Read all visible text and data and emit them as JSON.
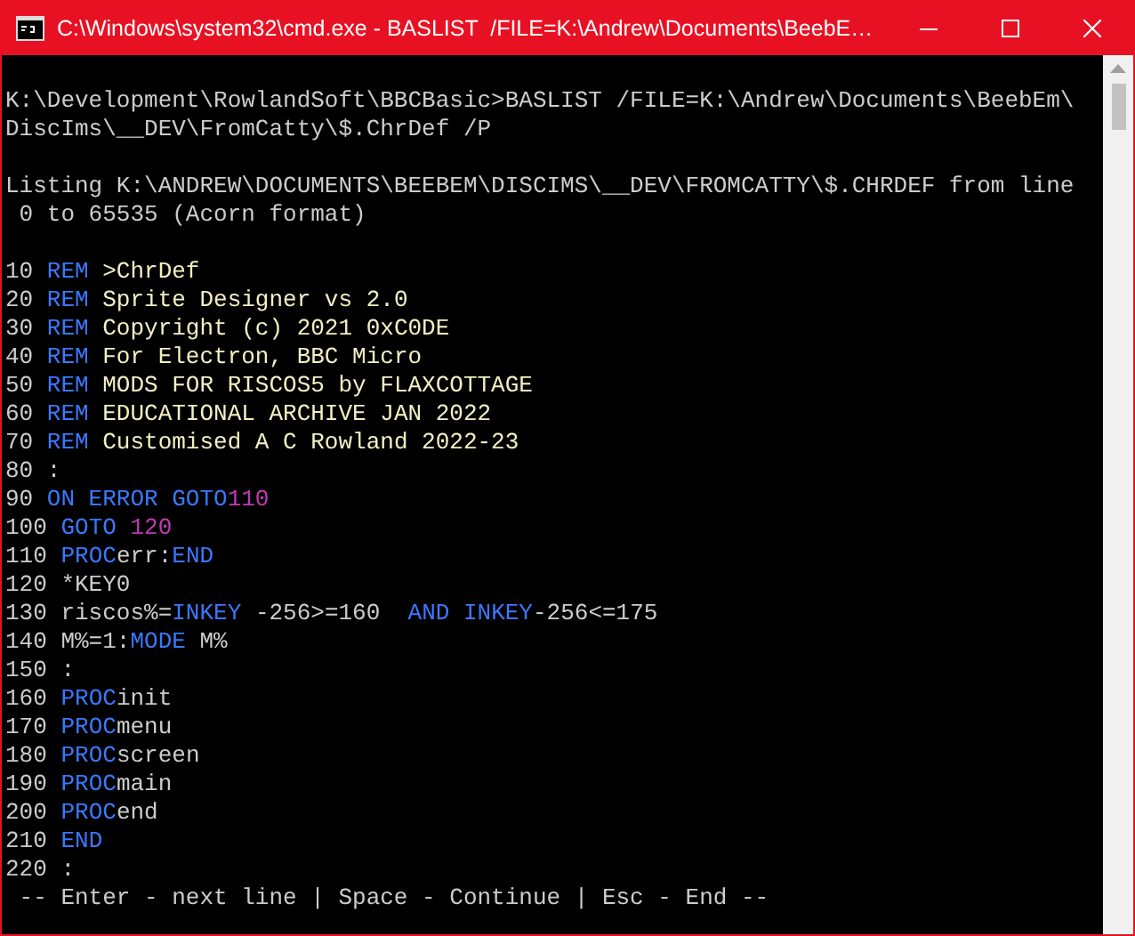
{
  "window": {
    "title": "C:\\Windows\\system32\\cmd.exe - BASLIST  /FILE=K:\\Andrew\\Documents\\BeebE…"
  },
  "console": {
    "blocks": [
      [
        [
          {
            "text": "K:\\Development\\RowlandSoft\\BBCBasic>BASLIST /FILE=K:\\Andrew\\Documents\\BeebEm\\",
            "kind": "plain"
          }
        ],
        [
          {
            "text": "DiscIms\\__DEV\\FromCatty\\$.ChrDef /P",
            "kind": "plain"
          }
        ]
      ],
      [
        [
          {
            "text": "Listing K:\\ANDREW\\DOCUMENTS\\BEEBEM\\DISCIMS\\__DEV\\FROMCATTY\\$.CHRDEF from line",
            "kind": "plain"
          }
        ],
        [
          {
            "text": " 0 to 65535 (Acorn format)",
            "kind": "plain"
          }
        ]
      ],
      [
        [
          {
            "text": "10 ",
            "kind": "plain"
          },
          {
            "text": "REM",
            "kind": "keyword"
          },
          {
            "text": " >ChrDef",
            "kind": "comment"
          }
        ],
        [
          {
            "text": "20 ",
            "kind": "plain"
          },
          {
            "text": "REM",
            "kind": "keyword"
          },
          {
            "text": " Sprite Designer vs 2.0",
            "kind": "comment"
          }
        ],
        [
          {
            "text": "30 ",
            "kind": "plain"
          },
          {
            "text": "REM",
            "kind": "keyword"
          },
          {
            "text": " Copyright (c) 2021 0xC0DE",
            "kind": "comment"
          }
        ],
        [
          {
            "text": "40 ",
            "kind": "plain"
          },
          {
            "text": "REM",
            "kind": "keyword"
          },
          {
            "text": " For Electron, BBC Micro",
            "kind": "comment"
          }
        ],
        [
          {
            "text": "50 ",
            "kind": "plain"
          },
          {
            "text": "REM",
            "kind": "keyword"
          },
          {
            "text": " MODS FOR RISCOS5 by FLAXCOTTAGE",
            "kind": "comment"
          }
        ],
        [
          {
            "text": "60 ",
            "kind": "plain"
          },
          {
            "text": "REM",
            "kind": "keyword"
          },
          {
            "text": " EDUCATIONAL ARCHIVE JAN 2022",
            "kind": "comment"
          }
        ],
        [
          {
            "text": "70 ",
            "kind": "plain"
          },
          {
            "text": "REM",
            "kind": "keyword"
          },
          {
            "text": " Customised A C Rowland 2022-23",
            "kind": "comment"
          }
        ],
        [
          {
            "text": "80 :",
            "kind": "plain"
          }
        ],
        [
          {
            "text": "90 ",
            "kind": "plain"
          },
          {
            "text": "ON ERROR GOTO",
            "kind": "keyword"
          },
          {
            "text": "110",
            "kind": "number"
          }
        ],
        [
          {
            "text": "100 ",
            "kind": "plain"
          },
          {
            "text": "GOTO ",
            "kind": "keyword"
          },
          {
            "text": "120",
            "kind": "number"
          }
        ],
        [
          {
            "text": "110 ",
            "kind": "plain"
          },
          {
            "text": "PROC",
            "kind": "keyword"
          },
          {
            "text": "err:",
            "kind": "plain"
          },
          {
            "text": "END",
            "kind": "keyword"
          }
        ],
        [
          {
            "text": "120 *KEY0",
            "kind": "plain"
          }
        ],
        [
          {
            "text": "130 riscos%=",
            "kind": "plain"
          },
          {
            "text": "INKEY",
            "kind": "keyword"
          },
          {
            "text": " -256>=160  ",
            "kind": "plain"
          },
          {
            "text": "AND INKEY",
            "kind": "keyword"
          },
          {
            "text": "-256<=175",
            "kind": "plain"
          }
        ],
        [
          {
            "text": "140 M%=1:",
            "kind": "plain"
          },
          {
            "text": "MODE",
            "kind": "keyword"
          },
          {
            "text": " M%",
            "kind": "plain"
          }
        ],
        [
          {
            "text": "150 :",
            "kind": "plain"
          }
        ],
        [
          {
            "text": "160 ",
            "kind": "plain"
          },
          {
            "text": "PROC",
            "kind": "keyword"
          },
          {
            "text": "init",
            "kind": "plain"
          }
        ],
        [
          {
            "text": "170 ",
            "kind": "plain"
          },
          {
            "text": "PROC",
            "kind": "keyword"
          },
          {
            "text": "menu",
            "kind": "plain"
          }
        ],
        [
          {
            "text": "180 ",
            "kind": "plain"
          },
          {
            "text": "PROC",
            "kind": "keyword"
          },
          {
            "text": "screen",
            "kind": "plain"
          }
        ],
        [
          {
            "text": "190 ",
            "kind": "plain"
          },
          {
            "text": "PROC",
            "kind": "keyword"
          },
          {
            "text": "main",
            "kind": "plain"
          }
        ],
        [
          {
            "text": "200 ",
            "kind": "plain"
          },
          {
            "text": "PROC",
            "kind": "keyword"
          },
          {
            "text": "end",
            "kind": "plain"
          }
        ],
        [
          {
            "text": "210 ",
            "kind": "plain"
          },
          {
            "text": "END",
            "kind": "keyword"
          }
        ],
        [
          {
            "text": "220 :",
            "kind": "plain"
          }
        ],
        [
          {
            "text": " -- Enter - next line | Space - Continue | Esc - End --",
            "kind": "plain"
          }
        ]
      ]
    ]
  }
}
